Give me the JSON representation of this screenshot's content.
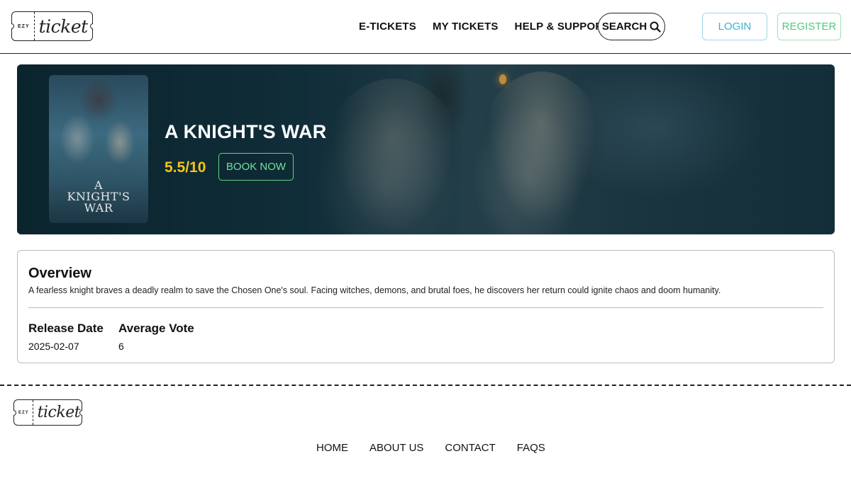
{
  "brand": {
    "ezy": "EZY",
    "script": "ticket"
  },
  "nav": {
    "items": [
      "E-TICKETS",
      "MY TICKETS",
      "HELP & SUPPORT"
    ],
    "search_label": "SEARCH",
    "login_label": "LOGIN",
    "register_label": "REGISTER"
  },
  "hero": {
    "poster_title_line1": "A",
    "poster_title_line2": "KNIGHT'S",
    "poster_title_line3": "WAR",
    "title": "A KNIGHT'S WAR",
    "rating": "5.5/10",
    "book_label": "BOOK NOW"
  },
  "overview": {
    "heading": "Overview",
    "description": "A fearless knight braves a deadly realm to save the Chosen One's soul. Facing witches, demons, and brutal foes, he discovers her return could ignite chaos and doom humanity.",
    "release_date_label": "Release Date",
    "release_date": "2025-02-07",
    "average_vote_label": "Average Vote",
    "average_vote": "6"
  },
  "footer": {
    "links": [
      "HOME",
      "ABOUT US",
      "CONTACT",
      "FAQS"
    ]
  },
  "colors": {
    "rating": "#f3c51a",
    "book_now": "#6fe39a",
    "login": "#3ab2cf",
    "register": "#4fcb7a"
  }
}
